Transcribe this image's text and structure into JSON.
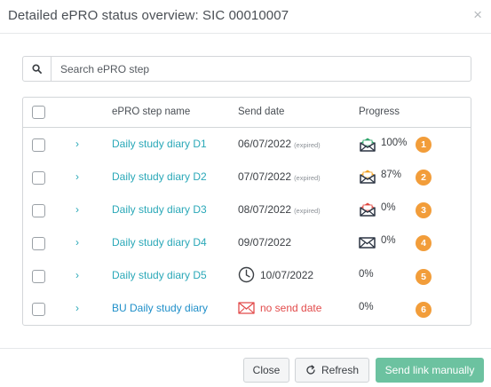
{
  "dialog": {
    "title": "Detailed ePRO status overview: SIC 00010007",
    "close_glyph": "×"
  },
  "search": {
    "placeholder": "Search ePRO step",
    "icon": "search-icon"
  },
  "table": {
    "columns": [
      "ePRO step name",
      "Send date",
      "Progress"
    ],
    "rows": [
      {
        "name": "Daily study diary D1",
        "send_date": "06/07/2022",
        "expired": "(expired)",
        "progress": "100%",
        "progress_value": 100,
        "status_icon": "envelope-open-green-icon",
        "badge": "1"
      },
      {
        "name": "Daily study diary D2",
        "send_date": "07/07/2022",
        "expired": "(expired)",
        "progress": "87%",
        "progress_value": 87,
        "status_icon": "envelope-open-orange-icon",
        "badge": "2"
      },
      {
        "name": "Daily study diary D3",
        "send_date": "08/07/2022",
        "expired": "(expired)",
        "progress": "0%",
        "progress_value": 0,
        "status_icon": "envelope-open-red-icon",
        "badge": "3"
      },
      {
        "name": "Daily study diary D4",
        "send_date": "09/07/2022",
        "expired": "",
        "progress": "0%",
        "progress_value": 0,
        "status_icon": "envelope-closed-icon",
        "badge": "4"
      },
      {
        "name": "Daily study diary D5",
        "send_date": "10/07/2022",
        "expired": "",
        "progress": "0%",
        "progress_value": 0,
        "status_icon": "clock-icon",
        "badge": "5"
      },
      {
        "name": "BU Daily study diary",
        "send_date": "no send date",
        "expired": "",
        "progress": "0%",
        "progress_value": 0,
        "status_icon": "envelope-red-outline-icon",
        "badge": "6"
      }
    ]
  },
  "footer": {
    "close_label": "Close",
    "refresh_label": "Refresh",
    "send_label": "Send link manually"
  },
  "colors": {
    "link": "#2aa8b8",
    "badge": "#f29d3a",
    "primary_button": "#6cc2a0",
    "no_send_date": "#e24b4b"
  }
}
